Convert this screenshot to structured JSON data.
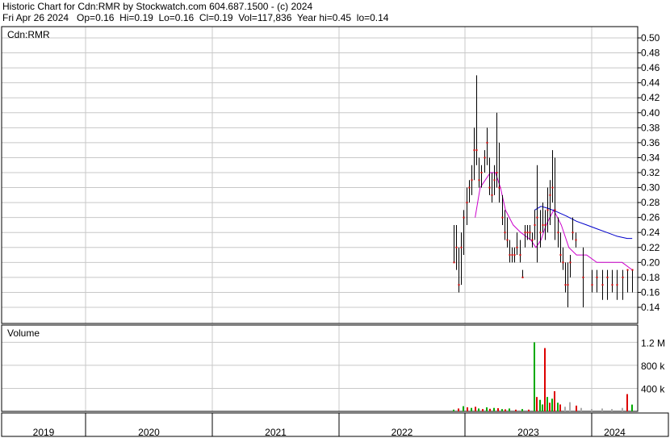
{
  "header": {
    "line1": "Historic Chart for Cdn:RMR by Stockwatch.com 604.687.1500 - (c) 2024",
    "line2": "Fri Apr 26 2024   Op=0.16  Hi=0.19  Lo=0.16  Cl=0.19  Vol=117,836  Year hi=0.45  lo=0.14"
  },
  "chart_data": {
    "type": "ohlc-bar-with-volume",
    "symbol_label": "Cdn:RMR",
    "price_ylim": [
      0.14,
      0.5
    ],
    "price_ticks": [
      "0.50",
      "0.48",
      "0.46",
      "0.44",
      "0.42",
      "0.40",
      "0.38",
      "0.36",
      "0.34",
      "0.32",
      "0.30",
      "0.28",
      "0.26",
      "0.24",
      "0.22",
      "0.20",
      "0.18",
      "0.16",
      "0.14"
    ],
    "volume_label": "Volume",
    "volume_ticks": [
      {
        "label": "1.2 M",
        "value": 1200000
      },
      {
        "label": "800 k",
        "value": 800000
      },
      {
        "label": "400 k",
        "value": 400000
      }
    ],
    "volume_max": 1500000,
    "years": [
      "2019",
      "2020",
      "2021",
      "2022",
      "2023",
      "2024"
    ],
    "grid": true,
    "colors": {
      "price_bar": "#000000",
      "close_tick": "#cc0000",
      "ma_short": "#cc00cc",
      "ma_long": "#0000cc",
      "vol_up": "#00aa00",
      "vol_down": "#dd0000",
      "vol_neutral": "#aaaaaa",
      "grid": "#c8c8c8"
    },
    "ohlc": [
      {
        "x": 2022.91,
        "h": 0.25,
        "l": 0.2,
        "c": 0.2
      },
      {
        "x": 2022.93,
        "h": 0.25,
        "l": 0.19,
        "c": 0.22
      },
      {
        "x": 2022.95,
        "h": 0.22,
        "l": 0.16,
        "c": 0.17
      },
      {
        "x": 2022.97,
        "h": 0.24,
        "l": 0.17,
        "c": 0.22
      },
      {
        "x": 2022.99,
        "h": 0.27,
        "l": 0.21,
        "c": 0.26
      },
      {
        "x": 2023.01,
        "h": 0.3,
        "l": 0.25,
        "c": 0.28
      },
      {
        "x": 2023.03,
        "h": 0.31,
        "l": 0.28,
        "c": 0.3
      },
      {
        "x": 2023.05,
        "h": 0.33,
        "l": 0.29,
        "c": 0.31
      },
      {
        "x": 2023.07,
        "h": 0.38,
        "l": 0.31,
        "c": 0.35
      },
      {
        "x": 2023.09,
        "h": 0.45,
        "l": 0.33,
        "c": 0.35
      },
      {
        "x": 2023.11,
        "h": 0.34,
        "l": 0.3,
        "c": 0.31
      },
      {
        "x": 2023.13,
        "h": 0.33,
        "l": 0.3,
        "c": 0.32
      },
      {
        "x": 2023.15,
        "h": 0.35,
        "l": 0.32,
        "c": 0.34
      },
      {
        "x": 2023.17,
        "h": 0.38,
        "l": 0.33,
        "c": 0.36
      },
      {
        "x": 2023.19,
        "h": 0.34,
        "l": 0.29,
        "c": 0.3
      },
      {
        "x": 2023.21,
        "h": 0.32,
        "l": 0.28,
        "c": 0.29
      },
      {
        "x": 2023.23,
        "h": 0.33,
        "l": 0.29,
        "c": 0.31
      },
      {
        "x": 2023.25,
        "h": 0.4,
        "l": 0.3,
        "c": 0.32
      },
      {
        "x": 2023.27,
        "h": 0.36,
        "l": 0.28,
        "c": 0.3
      },
      {
        "x": 2023.29,
        "h": 0.29,
        "l": 0.25,
        "c": 0.26
      },
      {
        "x": 2023.31,
        "h": 0.27,
        "l": 0.23,
        "c": 0.24
      },
      {
        "x": 2023.33,
        "h": 0.26,
        "l": 0.22,
        "c": 0.23
      },
      {
        "x": 2023.35,
        "h": 0.23,
        "l": 0.2,
        "c": 0.21
      },
      {
        "x": 2023.37,
        "h": 0.22,
        "l": 0.2,
        "c": 0.21
      },
      {
        "x": 2023.39,
        "h": 0.22,
        "l": 0.2,
        "c": 0.21
      },
      {
        "x": 2023.41,
        "h": 0.24,
        "l": 0.21,
        "c": 0.22
      },
      {
        "x": 2023.43,
        "h": 0.23,
        "l": 0.2,
        "c": 0.21
      },
      {
        "x": 2023.45,
        "h": 0.19,
        "l": 0.18,
        "c": 0.18
      },
      {
        "x": 2023.47,
        "h": 0.25,
        "l": 0.22,
        "c": 0.24
      },
      {
        "x": 2023.49,
        "h": 0.25,
        "l": 0.23,
        "c": 0.24
      },
      {
        "x": 2023.51,
        "h": 0.25,
        "l": 0.23,
        "c": 0.24
      },
      {
        "x": 2023.53,
        "h": 0.24,
        "l": 0.22,
        "c": 0.23
      },
      {
        "x": 2023.55,
        "h": 0.27,
        "l": 0.23,
        "c": 0.25
      },
      {
        "x": 2023.57,
        "h": 0.33,
        "l": 0.2,
        "c": 0.26
      },
      {
        "x": 2023.59,
        "h": 0.27,
        "l": 0.22,
        "c": 0.24
      },
      {
        "x": 2023.61,
        "h": 0.28,
        "l": 0.24,
        "c": 0.25
      },
      {
        "x": 2023.63,
        "h": 0.27,
        "l": 0.23,
        "c": 0.25
      },
      {
        "x": 2023.65,
        "h": 0.3,
        "l": 0.24,
        "c": 0.27
      },
      {
        "x": 2023.67,
        "h": 0.31,
        "l": 0.25,
        "c": 0.29
      },
      {
        "x": 2023.69,
        "h": 0.35,
        "l": 0.28,
        "c": 0.3
      },
      {
        "x": 2023.71,
        "h": 0.34,
        "l": 0.23,
        "c": 0.27
      },
      {
        "x": 2023.73,
        "h": 0.26,
        "l": 0.22,
        "c": 0.24
      },
      {
        "x": 2023.75,
        "h": 0.24,
        "l": 0.2,
        "c": 0.21
      },
      {
        "x": 2023.77,
        "h": 0.22,
        "l": 0.19,
        "c": 0.2
      },
      {
        "x": 2023.79,
        "h": 0.2,
        "l": 0.16,
        "c": 0.17
      },
      {
        "x": 2023.81,
        "h": 0.2,
        "l": 0.14,
        "c": 0.17
      },
      {
        "x": 2023.83,
        "h": 0.21,
        "l": 0.18,
        "c": 0.2
      },
      {
        "x": 2023.85,
        "h": 0.26,
        "l": 0.23,
        "c": 0.24
      },
      {
        "x": 2023.87,
        "h": 0.24,
        "l": 0.22,
        "c": 0.23
      },
      {
        "x": 2023.93,
        "h": 0.22,
        "l": 0.14,
        "c": 0.18
      },
      {
        "x": 2024.0,
        "h": 0.19,
        "l": 0.16,
        "c": 0.17
      },
      {
        "x": 2024.04,
        "h": 0.19,
        "l": 0.16,
        "c": 0.18
      },
      {
        "x": 2024.08,
        "h": 0.19,
        "l": 0.15,
        "c": 0.17
      },
      {
        "x": 2024.12,
        "h": 0.19,
        "l": 0.15,
        "c": 0.18
      },
      {
        "x": 2024.16,
        "h": 0.19,
        "l": 0.16,
        "c": 0.17
      },
      {
        "x": 2024.2,
        "h": 0.19,
        "l": 0.15,
        "c": 0.17
      },
      {
        "x": 2024.24,
        "h": 0.19,
        "l": 0.15,
        "c": 0.18
      },
      {
        "x": 2024.28,
        "h": 0.19,
        "l": 0.16,
        "c": 0.19
      },
      {
        "x": 2024.32,
        "h": 0.19,
        "l": 0.16,
        "c": 0.19
      }
    ],
    "ma_short": [
      [
        2023.08,
        0.26
      ],
      [
        2023.12,
        0.3
      ],
      [
        2023.16,
        0.31
      ],
      [
        2023.2,
        0.32
      ],
      [
        2023.24,
        0.32
      ],
      [
        2023.28,
        0.3
      ],
      [
        2023.32,
        0.27
      ],
      [
        2023.38,
        0.25
      ],
      [
        2023.44,
        0.24
      ],
      [
        2023.52,
        0.23
      ],
      [
        2023.56,
        0.22
      ],
      [
        2023.6,
        0.23
      ],
      [
        2023.64,
        0.25
      ],
      [
        2023.7,
        0.27
      ],
      [
        2023.76,
        0.25
      ],
      [
        2023.82,
        0.22
      ],
      [
        2023.88,
        0.21
      ],
      [
        2023.96,
        0.21
      ],
      [
        2024.04,
        0.2
      ],
      [
        2024.14,
        0.2
      ],
      [
        2024.24,
        0.2
      ],
      [
        2024.32,
        0.19
      ]
    ],
    "ma_long": [
      [
        2023.55,
        0.27
      ],
      [
        2023.6,
        0.275
      ],
      [
        2023.66,
        0.272
      ],
      [
        2023.72,
        0.268
      ],
      [
        2023.8,
        0.262
      ],
      [
        2023.88,
        0.255
      ],
      [
        2023.96,
        0.25
      ],
      [
        2024.04,
        0.245
      ],
      [
        2024.12,
        0.24
      ],
      [
        2024.2,
        0.235
      ],
      [
        2024.28,
        0.232
      ],
      [
        2024.32,
        0.232
      ]
    ],
    "volume": [
      {
        "x": 2022.91,
        "v": 30000,
        "d": "up"
      },
      {
        "x": 2022.95,
        "v": 50000,
        "d": "down"
      },
      {
        "x": 2022.99,
        "v": 90000,
        "d": "up"
      },
      {
        "x": 2023.02,
        "v": 70000,
        "d": "down"
      },
      {
        "x": 2023.05,
        "v": 60000,
        "d": "up"
      },
      {
        "x": 2023.08,
        "v": 80000,
        "d": "down"
      },
      {
        "x": 2023.11,
        "v": 50000,
        "d": "up"
      },
      {
        "x": 2023.14,
        "v": 40000,
        "d": "down"
      },
      {
        "x": 2023.17,
        "v": 70000,
        "d": "up"
      },
      {
        "x": 2023.2,
        "v": 45000,
        "d": "down"
      },
      {
        "x": 2023.23,
        "v": 60000,
        "d": "up"
      },
      {
        "x": 2023.26,
        "v": 55000,
        "d": "down"
      },
      {
        "x": 2023.29,
        "v": 40000,
        "d": "up"
      },
      {
        "x": 2023.32,
        "v": 35000,
        "d": "down"
      },
      {
        "x": 2023.35,
        "v": 50000,
        "d": "up"
      },
      {
        "x": 2023.4,
        "v": 30000,
        "d": "down"
      },
      {
        "x": 2023.45,
        "v": 40000,
        "d": "up"
      },
      {
        "x": 2023.5,
        "v": 30000,
        "d": "down"
      },
      {
        "x": 2023.55,
        "v": 1200000,
        "d": "up"
      },
      {
        "x": 2023.57,
        "v": 250000,
        "d": "down"
      },
      {
        "x": 2023.59,
        "v": 200000,
        "d": "up"
      },
      {
        "x": 2023.61,
        "v": 120000,
        "d": "up"
      },
      {
        "x": 2023.63,
        "v": 1100000,
        "d": "down"
      },
      {
        "x": 2023.65,
        "v": 250000,
        "d": "up"
      },
      {
        "x": 2023.67,
        "v": 150000,
        "d": "down"
      },
      {
        "x": 2023.69,
        "v": 220000,
        "d": "up"
      },
      {
        "x": 2023.71,
        "v": 350000,
        "d": "down"
      },
      {
        "x": 2023.73,
        "v": 150000,
        "d": "up"
      },
      {
        "x": 2023.75,
        "v": 120000,
        "d": "down"
      },
      {
        "x": 2023.79,
        "v": 80000,
        "d": "neutral"
      },
      {
        "x": 2023.83,
        "v": 160000,
        "d": "neutral"
      },
      {
        "x": 2023.88,
        "v": 100000,
        "d": "down"
      },
      {
        "x": 2023.92,
        "v": 60000,
        "d": "neutral"
      },
      {
        "x": 2024.0,
        "v": 40000,
        "d": "neutral"
      },
      {
        "x": 2024.08,
        "v": 50000,
        "d": "neutral"
      },
      {
        "x": 2024.16,
        "v": 40000,
        "d": "neutral"
      },
      {
        "x": 2024.24,
        "v": 60000,
        "d": "neutral"
      },
      {
        "x": 2024.28,
        "v": 300000,
        "d": "down"
      },
      {
        "x": 2024.32,
        "v": 117836,
        "d": "up"
      }
    ]
  }
}
